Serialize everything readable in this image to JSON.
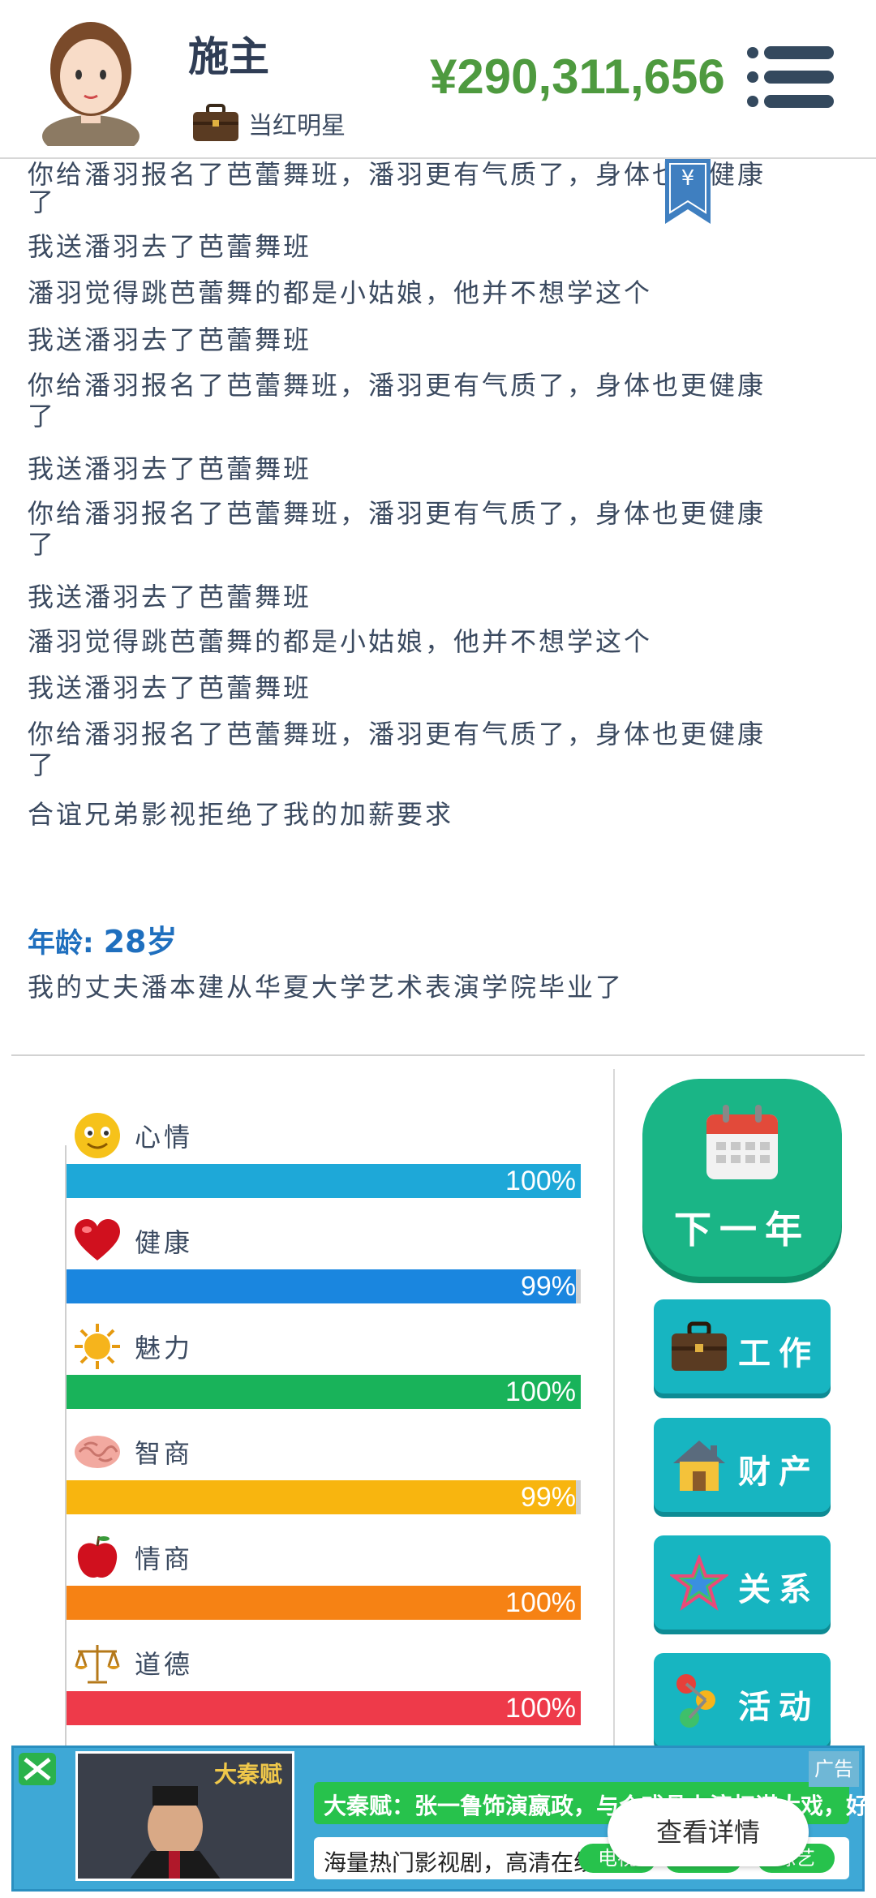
{
  "header": {
    "player_name": "施主",
    "job_title": "当红明星",
    "money": "¥290,311,656",
    "bookmark_symbol": "¥"
  },
  "log": {
    "lines": [
      "你给潘羽报名了芭蕾舞班，潘羽更有气质了，身体也更健康",
      "了",
      "我送潘羽去了芭蕾舞班",
      "潘羽觉得跳芭蕾舞的都是小姑娘，他并不想学这个",
      "我送潘羽去了芭蕾舞班",
      "你给潘羽报名了芭蕾舞班，潘羽更有气质了，身体也更健康",
      "了",
      "我送潘羽去了芭蕾舞班",
      "你给潘羽报名了芭蕾舞班，潘羽更有气质了，身体也更健康",
      "了",
      "我送潘羽去了芭蕾舞班",
      "潘羽觉得跳芭蕾舞的都是小姑娘，他并不想学这个",
      "我送潘羽去了芭蕾舞班",
      "你给潘羽报名了芭蕾舞班，潘羽更有气质了，身体也更健康",
      "了",
      "合谊兄弟影视拒绝了我的加薪要求"
    ],
    "age_label": "年龄:",
    "age_value": "28岁",
    "age_event": "我的丈夫潘本建从华夏大学艺术表演学院毕业了"
  },
  "stats": [
    {
      "label": "心情",
      "icon": "smiley-icon",
      "value": 100,
      "display": "100%",
      "color": "#1ea8d8"
    },
    {
      "label": "健康",
      "icon": "heart-icon",
      "value": 99,
      "display": "99%",
      "color": "#1a86df"
    },
    {
      "label": "魅力",
      "icon": "sun-icon",
      "value": 100,
      "display": "100%",
      "color": "#19b35a"
    },
    {
      "label": "智商",
      "icon": "brain-icon",
      "value": 99,
      "display": "99%",
      "color": "#f8b50f"
    },
    {
      "label": "情商",
      "icon": "apple-icon",
      "value": 100,
      "display": "100%",
      "color": "#f68214"
    },
    {
      "label": "道德",
      "icon": "scale-icon",
      "value": 100,
      "display": "100%",
      "color": "#ee3a4a"
    }
  ],
  "actions": {
    "next_year": "下一年",
    "work": "工作",
    "property": "财产",
    "relations": "关系",
    "activities": "活动"
  },
  "ad": {
    "thumb_title": "大秦赋",
    "title": "大秦赋：张一鲁饰演嬴政，与众戏骨上演权谋大戏，好架",
    "subtitle": "海量热门影视剧，高清在线看",
    "cta": "查看详情",
    "tag": "广告",
    "pill_left": "电视",
    "pill_mid": "电影",
    "pill_right": "综艺"
  }
}
